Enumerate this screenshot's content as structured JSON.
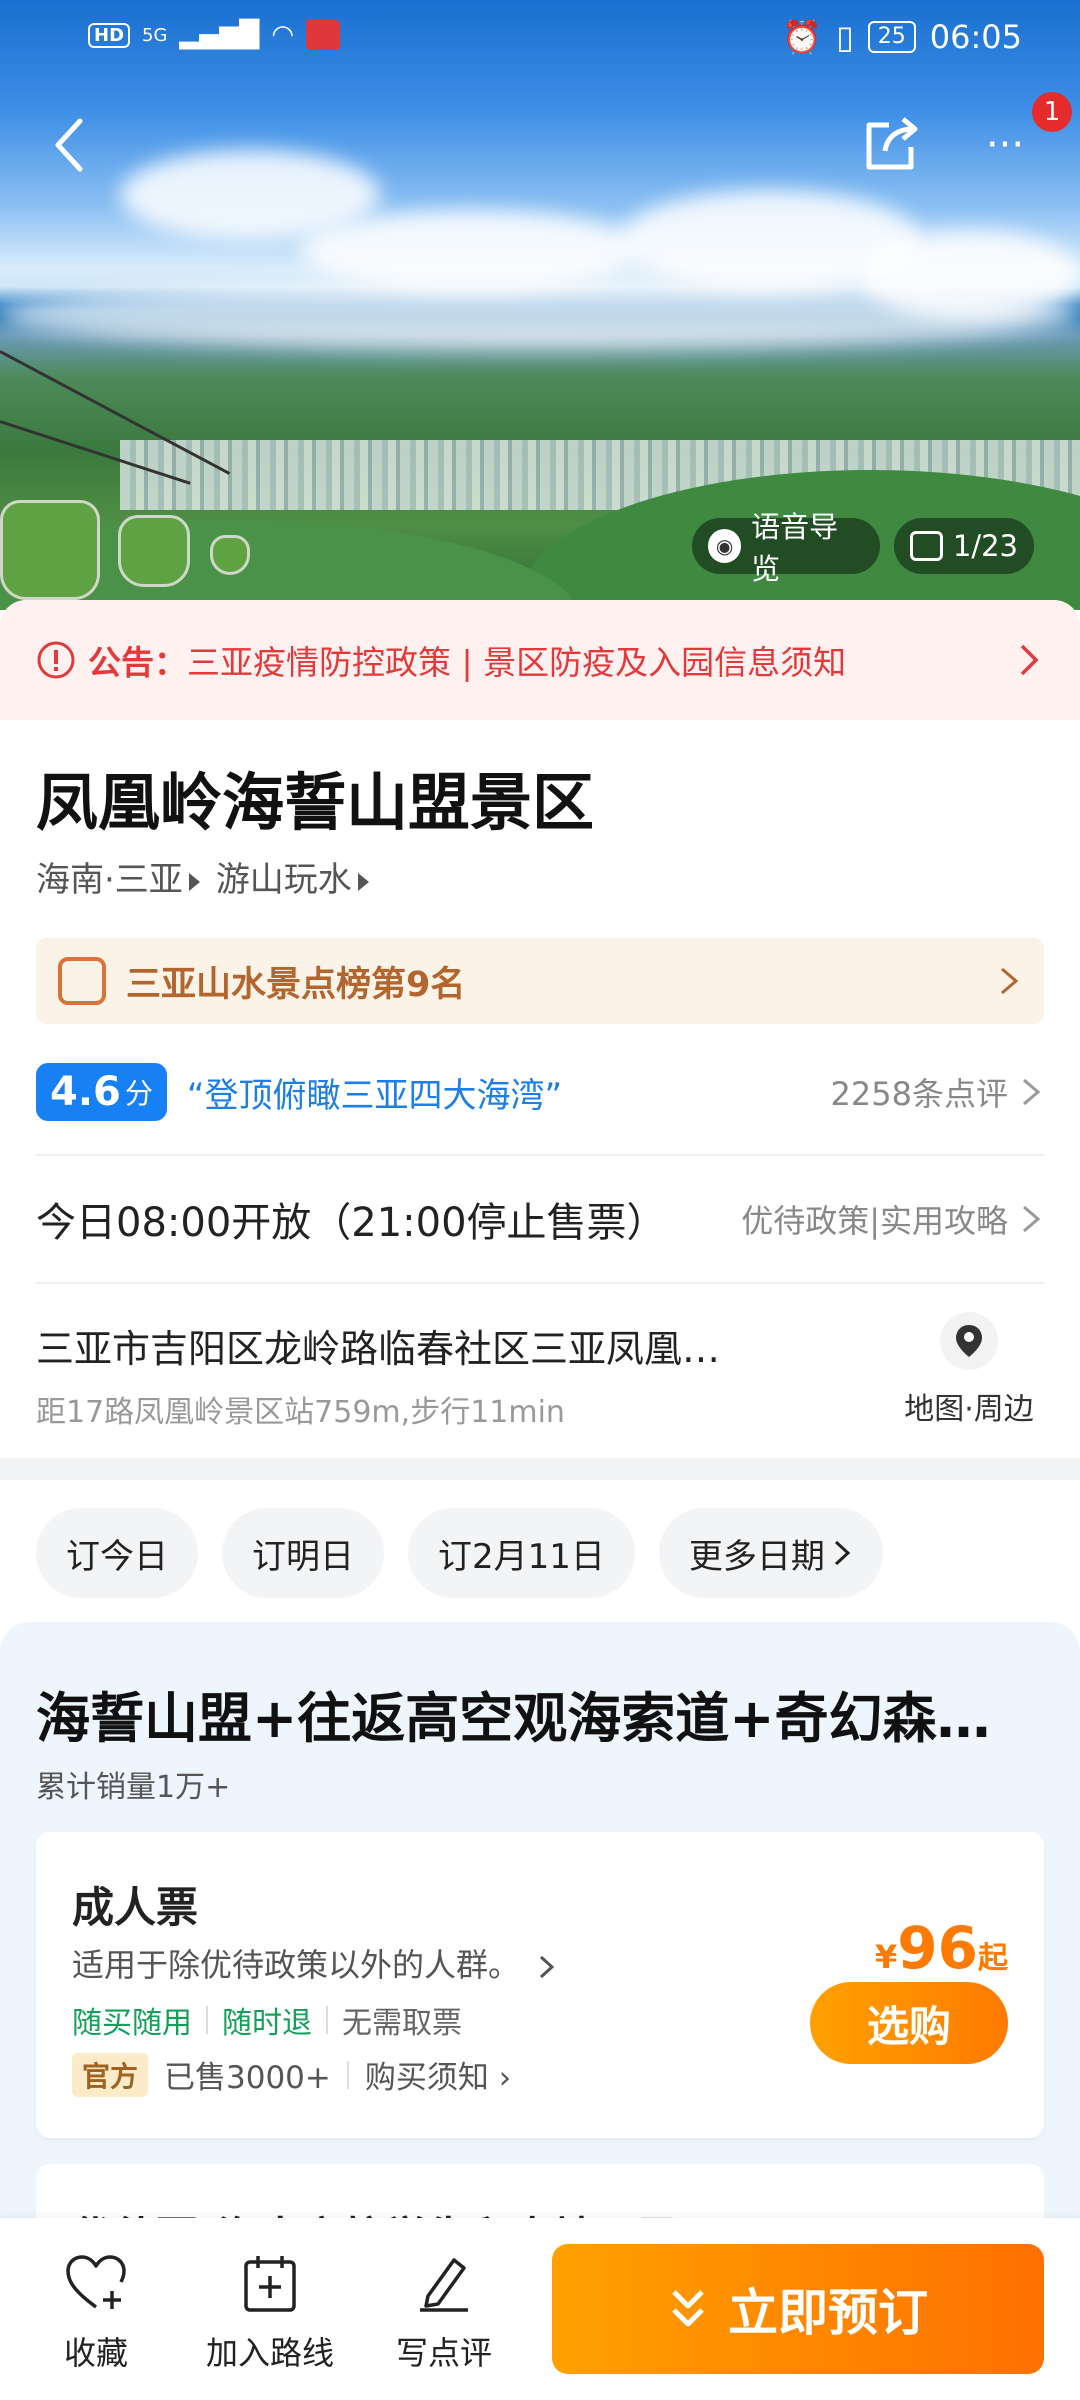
{
  "status_bar": {
    "network": "5G",
    "battery": "25",
    "time": "06:05"
  },
  "header": {
    "notification_count": "1"
  },
  "hero": {
    "audio_guide_label": "语音导览",
    "photo_counter": "1/23"
  },
  "notice": {
    "prefix": "公告：",
    "text": "三亚疫情防控政策 | 景区防疫及入园信息须知"
  },
  "attraction": {
    "title": "凤凰岭海誓山盟景区",
    "location": "海南·三亚",
    "category": "游山玩水",
    "ranking": "三亚山水景点榜第9名",
    "score": "4.6",
    "score_unit": "分",
    "quote": "“登顶俯瞰三亚四大海湾”",
    "reviews": "2258条点评",
    "opening": "今日08:00开放（21:00停止售票）",
    "opening_links": "优待政策|实用攻略",
    "address": "三亚市吉阳区龙岭路临春社区三亚凤凰…",
    "distance": "距17路凤凰岭景区站759m,步行11min",
    "map_label": "地图·周边"
  },
  "date_chips": [
    "订今日",
    "订明日",
    "订2月11日",
    "更多日期"
  ],
  "product": {
    "title": "海誓山盟+往返高空观海索道+奇幻森…",
    "sales": "累计销量1万+",
    "ticket": {
      "name": "成人票",
      "desc": "适用于除优待政策以外的人群。",
      "tags": [
        "随买随用",
        "随时退",
        "无需取票"
      ],
      "official": "官方",
      "sold": "已售3000+",
      "notice_link": "购买须知",
      "currency": "¥",
      "price": "96",
      "price_suffix": "起",
      "buy_label": "选购"
    },
    "ticket2_name": "优待票(海南高校学生和本地居民)"
  },
  "bottom_bar": {
    "favorite": "收藏",
    "add_route": "加入路线",
    "write_review": "写点评",
    "book_now": "立即预订"
  },
  "colors": {
    "accent_orange": "#ff7a00",
    "notice_red": "#e23a3a",
    "score_blue": "#1780f5",
    "tag_green": "#14a05a"
  }
}
